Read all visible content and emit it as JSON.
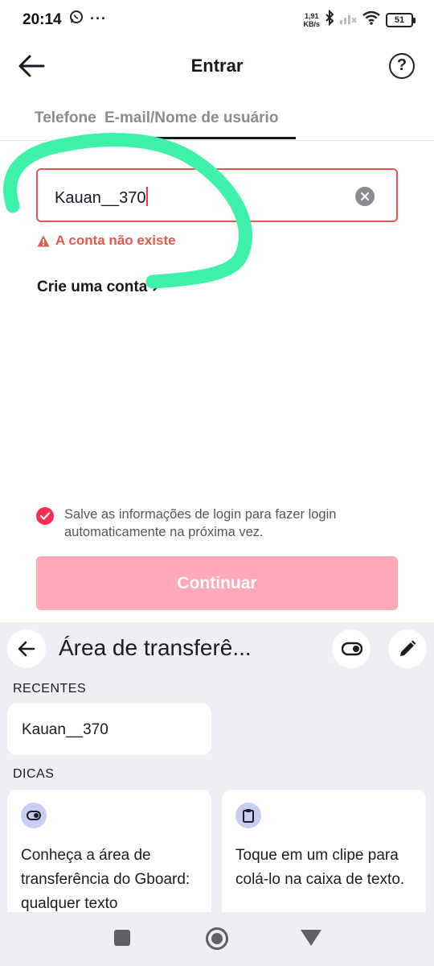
{
  "status_bar": {
    "time": "20:14",
    "more": "···",
    "speed_top": "1,91",
    "speed_bottom": "KB/s",
    "battery": "51",
    "icons": [
      "whatsapp-icon",
      "bluetooth-icon",
      "signal-icon",
      "wifi-icon",
      "battery-icon"
    ]
  },
  "header": {
    "title": "Entrar",
    "help": "?"
  },
  "tabs": {
    "phone": "Telefone",
    "email": "E-mail/Nome de usuário",
    "active": "email"
  },
  "form": {
    "username_value": "Kauan__370",
    "error": "A conta não existe",
    "create_account": "Crie uma conta"
  },
  "save_login": {
    "text": "Salve as informações de login para fazer login automaticamente na próxima vez.",
    "checked": true
  },
  "continue_label": "Continuar",
  "keyboard": {
    "title": "Área de transferê...",
    "recent_label": "RECENTES",
    "recent_clip": "Kauan__370",
    "tips_label": "DICAS",
    "tip1": "Conheça a área de transferência do Gboard: qualquer texto",
    "tip2": "Toque em um clipe para colá-lo na caixa de texto."
  },
  "colors": {
    "accent": "#fe2c55",
    "error": "#e8554e",
    "continue_disabled": "#fea8b8",
    "scribble": "#3df2a8",
    "keyboard_bg": "#eeeef4"
  }
}
